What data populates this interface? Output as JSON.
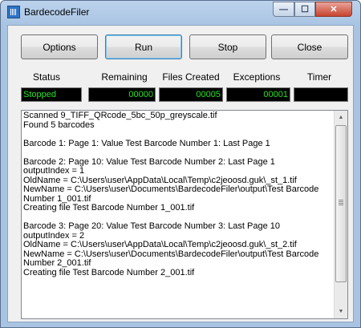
{
  "window": {
    "title": "BardecodeFiler",
    "icon": "barcode-icon",
    "controls": {
      "minimize": "—",
      "maximize": "☐",
      "close": "✕"
    }
  },
  "buttons": {
    "options": "Options",
    "run": "Run",
    "stop": "Stop",
    "close": "Close"
  },
  "labels": {
    "status": "Status",
    "remaining": "Remaining",
    "files_created": "Files Created",
    "exceptions": "Exceptions",
    "timer": "Timer"
  },
  "values": {
    "status": "Stopped",
    "remaining": "00000",
    "files_created": "00005",
    "exceptions": "00001",
    "timer": ""
  },
  "colors": {
    "value_text": "#22e322",
    "value_background": "#000000"
  },
  "log": {
    "text": "Scanned 9_TIFF_QRcode_5bc_50p_greyscale.tif\nFound 5 barcodes\n\nBarcode 1: Page 1: Value Test Barcode Number 1: Last Page 1\n\nBarcode 2: Page 10: Value Test Barcode Number 2: Last Page 1\noutputIndex = 1\nOldName = C:\\Users\\user\\AppData\\Local\\Temp\\c2jeoosd.guk\\_st_1.tif\nNewName = C:\\Users\\user\\Documents\\BardecodeFiler\\output\\Test Barcode Number 1_001.tif\nCreating file Test Barcode Number 1_001.tif\n\nBarcode 3: Page 20: Value Test Barcode Number 3: Last Page 10\noutputIndex = 2\nOldName = C:\\Users\\user\\AppData\\Local\\Temp\\c2jeoosd.guk\\_st_2.tif\nNewName = C:\\Users\\user\\Documents\\BardecodeFiler\\output\\Test Barcode Number 2_001.tif\nCreating file Test Barcode Number 2_001.tif"
  },
  "scrollbar": {
    "up": "▲",
    "down": "▼"
  }
}
